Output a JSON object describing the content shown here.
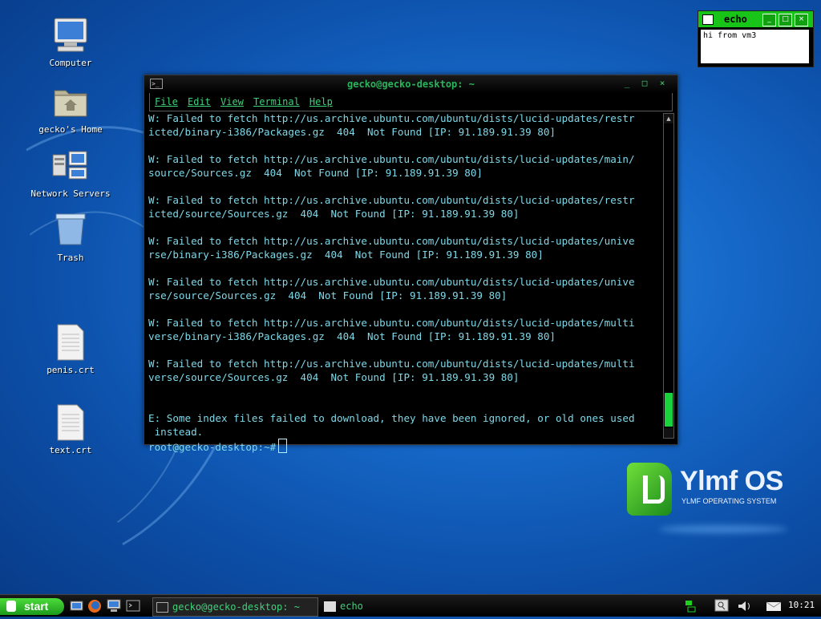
{
  "desktop": {
    "icons": [
      {
        "label": "Computer"
      },
      {
        "label": "gecko's Home"
      },
      {
        "label": "Network Servers"
      },
      {
        "label": "Trash"
      },
      {
        "label": "penis.crt"
      },
      {
        "label": "text.crt"
      }
    ]
  },
  "terminal": {
    "title": "gecko@gecko-desktop: ~",
    "buttons": [
      "_",
      "□",
      "×"
    ],
    "menu": [
      "File",
      "Edit",
      "View",
      "Terminal",
      "Help"
    ],
    "lines": [
      "W: Failed to fetch http://us.archive.ubuntu.com/ubuntu/dists/lucid-updates/restr",
      "icted/binary-i386/Packages.gz  404  Not Found [IP: 91.189.91.39 80]",
      "",
      "W: Failed to fetch http://us.archive.ubuntu.com/ubuntu/dists/lucid-updates/main/",
      "source/Sources.gz  404  Not Found [IP: 91.189.91.39 80]",
      "",
      "W: Failed to fetch http://us.archive.ubuntu.com/ubuntu/dists/lucid-updates/restr",
      "icted/source/Sources.gz  404  Not Found [IP: 91.189.91.39 80]",
      "",
      "W: Failed to fetch http://us.archive.ubuntu.com/ubuntu/dists/lucid-updates/unive",
      "rse/binary-i386/Packages.gz  404  Not Found [IP: 91.189.91.39 80]",
      "",
      "W: Failed to fetch http://us.archive.ubuntu.com/ubuntu/dists/lucid-updates/unive",
      "rse/source/Sources.gz  404  Not Found [IP: 91.189.91.39 80]",
      "",
      "W: Failed to fetch http://us.archive.ubuntu.com/ubuntu/dists/lucid-updates/multi",
      "verse/binary-i386/Packages.gz  404  Not Found [IP: 91.189.91.39 80]",
      "",
      "W: Failed to fetch http://us.archive.ubuntu.com/ubuntu/dists/lucid-updates/multi",
      "verse/source/Sources.gz  404  Not Found [IP: 91.189.91.39 80]",
      "",
      "",
      "E: Some index files failed to download, they have been ignored, or old ones used",
      " instead."
    ],
    "prompt": "root@gecko-desktop:~#"
  },
  "echo_window": {
    "title": "echo",
    "text": "hi from vm3",
    "buttons": [
      "_",
      "□",
      "×"
    ]
  },
  "logo": {
    "name": "Ylmf OS",
    "subtitle": "YLMF OPERATING SYSTEM"
  },
  "taskbar": {
    "start_label": "start",
    "tasks": [
      {
        "label": "gecko@gecko-desktop: ~"
      },
      {
        "label": "echo"
      }
    ],
    "clock": "10:21"
  },
  "colors": {
    "terminal_text": "#7fd8e8",
    "terminal_title": "#27b45a",
    "accent_green": "#19c419"
  }
}
